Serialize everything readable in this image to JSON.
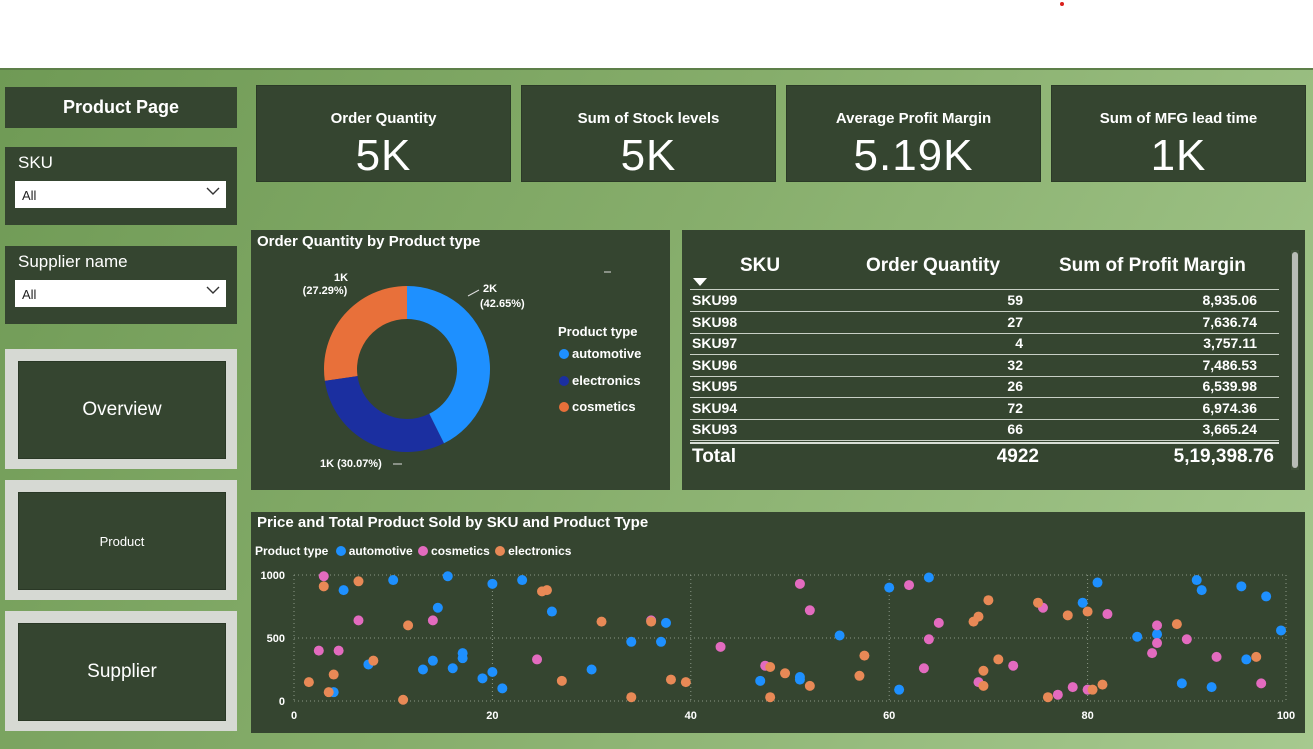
{
  "page": {
    "title": "Product Page"
  },
  "slicers": [
    {
      "label": "SKU",
      "value": "All"
    },
    {
      "label": "Supplier name",
      "value": "All"
    }
  ],
  "nav": {
    "overview": "Overview",
    "product": "Product",
    "supplier": "Supplier"
  },
  "kpis": [
    {
      "title": "Order Quantity",
      "value": "5K"
    },
    {
      "title": "Sum of Stock levels",
      "value": "5K"
    },
    {
      "title": "Average Profit Margin",
      "value": "5.19K"
    },
    {
      "title": "Sum of MFG lead time",
      "value": "1K"
    }
  ],
  "donut": {
    "title": "Order Quantity by Product type",
    "legend_title": "Product type",
    "slices": [
      {
        "name": "automotive",
        "pct": 42.65,
        "label": "2K",
        "pct_label": "(42.65%)",
        "color": "#1e90ff"
      },
      {
        "name": "electronics",
        "pct": 30.07,
        "label": "1K (30.07%)",
        "color": "#1b2fa0"
      },
      {
        "name": "cosmetics",
        "pct": 27.29,
        "label": "1K",
        "pct_label": "(27.29%)",
        "color": "#e8703a"
      }
    ]
  },
  "table": {
    "headers": [
      "SKU",
      "Order Quantity",
      "Sum of Profit Margin"
    ],
    "rows": [
      [
        "SKU99",
        "59",
        "8,935.06"
      ],
      [
        "SKU98",
        "27",
        "7,636.74"
      ],
      [
        "SKU97",
        "4",
        "3,757.11"
      ],
      [
        "SKU96",
        "32",
        "7,486.53"
      ],
      [
        "SKU95",
        "26",
        "6,539.98"
      ],
      [
        "SKU94",
        "72",
        "6,974.36"
      ],
      [
        "SKU93",
        "66",
        "3,665.24"
      ]
    ],
    "total": [
      "Total",
      "4922",
      "5,19,398.76"
    ]
  },
  "chart_data": {
    "type": "scatter",
    "title": "Price and Total Product Sold by SKU and Product Type",
    "legend_title": "Product type",
    "xlim": [
      0,
      100
    ],
    "ylim": [
      0,
      1000
    ],
    "xticks": [
      "0",
      "20",
      "40",
      "60",
      "80",
      "100"
    ],
    "yticks": [
      "0",
      "500",
      "1000"
    ],
    "grid": true,
    "series": [
      {
        "name": "automotive",
        "color": "#1e90ff",
        "points": [
          [
            4,
            70
          ],
          [
            5,
            880
          ],
          [
            7.5,
            290
          ],
          [
            10,
            960
          ],
          [
            13,
            250
          ],
          [
            14,
            320
          ],
          [
            14.5,
            740
          ],
          [
            15.5,
            990
          ],
          [
            16,
            260
          ],
          [
            17,
            340
          ],
          [
            17,
            380
          ],
          [
            19,
            180
          ],
          [
            20,
            930
          ],
          [
            20,
            230
          ],
          [
            21,
            100
          ],
          [
            23,
            960
          ],
          [
            26,
            710
          ],
          [
            30,
            250
          ],
          [
            34,
            470
          ],
          [
            37,
            470
          ],
          [
            37.5,
            620
          ],
          [
            47,
            160
          ],
          [
            51,
            170
          ],
          [
            51,
            190
          ],
          [
            55,
            520
          ],
          [
            60,
            900
          ],
          [
            61,
            90
          ],
          [
            64,
            980
          ],
          [
            79.5,
            780
          ],
          [
            81,
            940
          ],
          [
            85,
            510
          ],
          [
            87,
            530
          ],
          [
            89.5,
            140
          ],
          [
            91,
            960
          ],
          [
            91.5,
            880
          ],
          [
            92.5,
            110
          ],
          [
            95.5,
            910
          ],
          [
            96,
            330
          ],
          [
            98,
            830
          ],
          [
            99.5,
            560
          ]
        ]
      },
      {
        "name": "cosmetics",
        "color": "#e36bbf",
        "points": [
          [
            2.5,
            400
          ],
          [
            3,
            990
          ],
          [
            4.5,
            400
          ],
          [
            6.5,
            640
          ],
          [
            14,
            640
          ],
          [
            24.5,
            330
          ],
          [
            36,
            640
          ],
          [
            43,
            430
          ],
          [
            47.5,
            280
          ],
          [
            51,
            930
          ],
          [
            52,
            720
          ],
          [
            62,
            920
          ],
          [
            63.5,
            260
          ],
          [
            64,
            490
          ],
          [
            65,
            620
          ],
          [
            69,
            150
          ],
          [
            72.5,
            280
          ],
          [
            75.5,
            740
          ],
          [
            77,
            50
          ],
          [
            78.5,
            110
          ],
          [
            80,
            90
          ],
          [
            82,
            690
          ],
          [
            86.5,
            380
          ],
          [
            87,
            600
          ],
          [
            87,
            460
          ],
          [
            90,
            490
          ],
          [
            93,
            350
          ],
          [
            97.5,
            140
          ]
        ]
      },
      {
        "name": "electronics",
        "color": "#e88956",
        "points": [
          [
            1.5,
            150
          ],
          [
            3,
            910
          ],
          [
            3.5,
            70
          ],
          [
            4,
            210
          ],
          [
            6.5,
            950
          ],
          [
            8,
            320
          ],
          [
            11,
            10
          ],
          [
            11.5,
            600
          ],
          [
            25,
            870
          ],
          [
            25.5,
            880
          ],
          [
            27,
            160
          ],
          [
            31,
            630
          ],
          [
            34,
            30
          ],
          [
            36,
            630
          ],
          [
            38,
            170
          ],
          [
            39.5,
            150
          ],
          [
            48,
            30
          ],
          [
            48,
            270
          ],
          [
            49.5,
            220
          ],
          [
            52,
            120
          ],
          [
            57,
            200
          ],
          [
            57.5,
            360
          ],
          [
            68.5,
            630
          ],
          [
            69,
            670
          ],
          [
            69.5,
            240
          ],
          [
            69.5,
            120
          ],
          [
            70,
            800
          ],
          [
            71,
            330
          ],
          [
            75,
            780
          ],
          [
            76,
            30
          ],
          [
            78,
            680
          ],
          [
            80,
            710
          ],
          [
            80.5,
            90
          ],
          [
            81.5,
            130
          ],
          [
            89,
            610
          ],
          [
            97,
            350
          ]
        ]
      }
    ]
  }
}
